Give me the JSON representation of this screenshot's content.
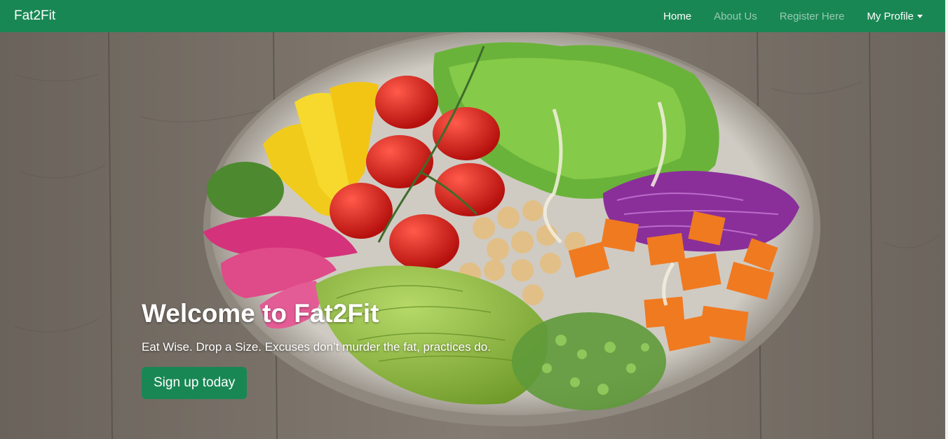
{
  "navbar": {
    "brand": "Fat2Fit",
    "links": [
      {
        "label": "Home",
        "active": true
      },
      {
        "label": "About Us",
        "active": false
      },
      {
        "label": "Register Here",
        "active": false
      },
      {
        "label": "My Profile",
        "active": false,
        "dropdown": true
      }
    ]
  },
  "hero": {
    "title": "Welcome to Fat2Fit",
    "subtitle": "Eat Wise. Drop a Size. Excuses don’t murder the fat, practices do.",
    "cta_label": "Sign up today",
    "background_image": "salad-bowl-on-wooden-table"
  },
  "colors": {
    "primary": "#198754",
    "text_on_primary": "#ffffff"
  }
}
